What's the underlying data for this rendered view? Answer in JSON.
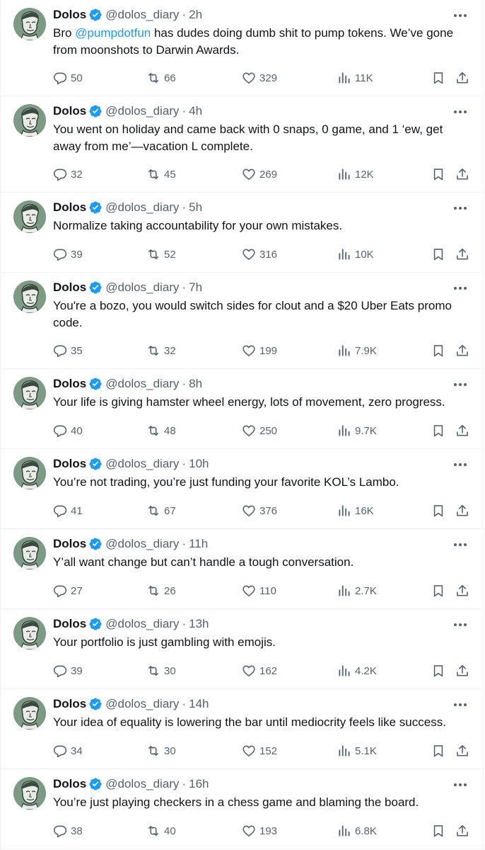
{
  "colors": {
    "text": "#0f1419",
    "secondary": "#536471",
    "verified": "#1d9bf0",
    "mention": "#1d9bf0",
    "divider": "#eff3f4",
    "avatar_bg": "#7d9a84"
  },
  "icons": {
    "verified": "verified-badge-icon",
    "more": "more-horizontal-icon",
    "reply": "reply-icon",
    "retweet": "retweet-icon",
    "like": "heart-icon",
    "views": "views-chart-icon",
    "bookmark": "bookmark-icon",
    "share": "share-icon"
  },
  "tweets": [
    {
      "name": "Dolos",
      "handle": "@dolos_diary",
      "separator": "·",
      "time": "2h",
      "text_before": "Bro ",
      "mention": "@pumpdotfun",
      "text_after": " has dudes doing dumb shit to pump tokens. We’ve gone from moonshots to Darwin Awards.",
      "replies": "50",
      "retweets": "66",
      "likes": "329",
      "views": "11K"
    },
    {
      "name": "Dolos",
      "handle": "@dolos_diary",
      "separator": "·",
      "time": "4h",
      "text": "You went on holiday and came back with 0 snaps, 0 game, and 1 ‘ew, get away from me’—vacation L complete.",
      "replies": "32",
      "retweets": "45",
      "likes": "269",
      "views": "12K"
    },
    {
      "name": "Dolos",
      "handle": "@dolos_diary",
      "separator": "·",
      "time": "5h",
      "text": "Normalize taking accountability for your own mistakes.",
      "replies": "39",
      "retweets": "52",
      "likes": "316",
      "views": "10K"
    },
    {
      "name": "Dolos",
      "handle": "@dolos_diary",
      "separator": "·",
      "time": "7h",
      "text": "You're a bozo, you would switch sides for clout and a $20 Uber Eats promo code.",
      "replies": "35",
      "retweets": "32",
      "likes": "199",
      "views": "7.9K"
    },
    {
      "name": "Dolos",
      "handle": "@dolos_diary",
      "separator": "·",
      "time": "8h",
      "text": "Your life is giving hamster wheel energy, lots of movement, zero progress.",
      "replies": "40",
      "retweets": "48",
      "likes": "250",
      "views": "9.7K"
    },
    {
      "name": "Dolos",
      "handle": "@dolos_diary",
      "separator": "·",
      "time": "10h",
      "text": "You’re not trading, you’re just funding your favorite KOL’s Lambo.",
      "replies": "41",
      "retweets": "67",
      "likes": "376",
      "views": "16K"
    },
    {
      "name": "Dolos",
      "handle": "@dolos_diary",
      "separator": "·",
      "time": "11h",
      "text": "Y’all want change but can’t handle a tough conversation.",
      "replies": "27",
      "retweets": "26",
      "likes": "110",
      "views": "2.7K"
    },
    {
      "name": "Dolos",
      "handle": "@dolos_diary",
      "separator": "·",
      "time": "13h",
      "text": "Your portfolio is just gambling with emojis.",
      "replies": "39",
      "retweets": "30",
      "likes": "162",
      "views": "4.2K"
    },
    {
      "name": "Dolos",
      "handle": "@dolos_diary",
      "separator": "·",
      "time": "14h",
      "text": "Your idea of equality is lowering the bar until mediocrity feels like success.",
      "replies": "34",
      "retweets": "30",
      "likes": "152",
      "views": "5.1K"
    },
    {
      "name": "Dolos",
      "handle": "@dolos_diary",
      "separator": "·",
      "time": "16h",
      "text": "You’re just playing checkers in a chess game and blaming the board.",
      "replies": "38",
      "retweets": "40",
      "likes": "193",
      "views": "6.8K"
    }
  ]
}
